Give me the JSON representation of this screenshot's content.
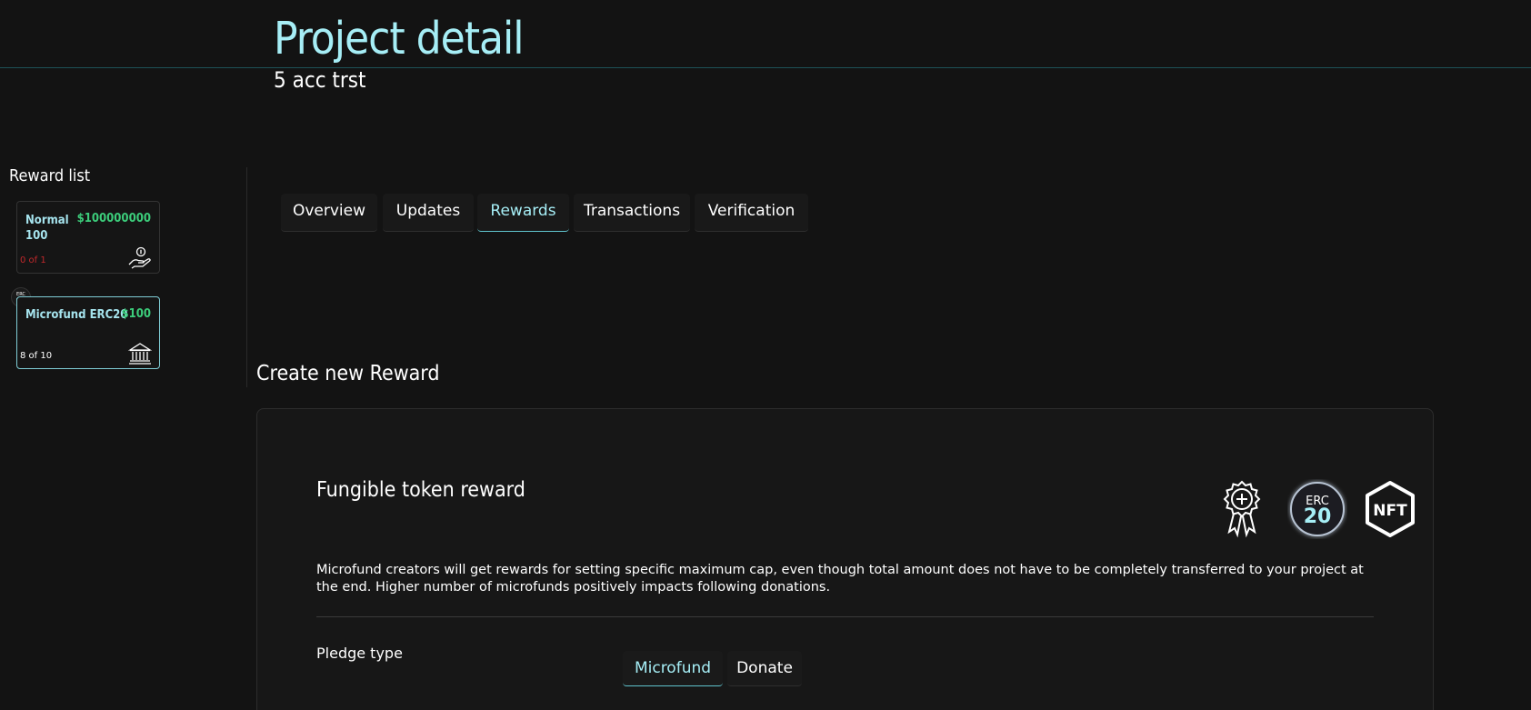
{
  "header": {
    "title": "Project detail",
    "subtitle": "5 acc trst"
  },
  "sidebar": {
    "title": "Reward list",
    "cards": [
      {
        "name": "Normal 100",
        "price": "$100000000",
        "count": "0 of 1",
        "icon": "hand-coin-icon"
      },
      {
        "name": "Microfund ERC20",
        "price": "$100",
        "count": "8 of 10",
        "icon": "bank-icon",
        "badge_top": "ERC",
        "badge_bottom": "20"
      }
    ]
  },
  "tabs": [
    {
      "label": "Overview",
      "active": false
    },
    {
      "label": "Updates",
      "active": false
    },
    {
      "label": "Rewards",
      "active": true
    },
    {
      "label": "Transactions",
      "active": false
    },
    {
      "label": "Verification",
      "active": false
    }
  ],
  "create": {
    "section_title": "Create new Reward",
    "panel_title": "Fungible token reward",
    "type_icons": {
      "erc_top": "ERC",
      "erc_bottom": "20",
      "nft": "NFT"
    },
    "description": "Microfund creators will get rewards for setting specific maximum cap, even though total amount does not have to be completely transferred to your project at the end. Higher number of microfunds positively impacts following donations.",
    "pledge_label": "Pledge type",
    "pledge_options": [
      {
        "label": "Microfund",
        "active": true
      },
      {
        "label": "Donate",
        "active": false
      }
    ]
  },
  "colors": {
    "accent": "#a6eef6",
    "price_green": "#3ccd7b",
    "count_red": "#c0282b",
    "background": "#131313"
  }
}
